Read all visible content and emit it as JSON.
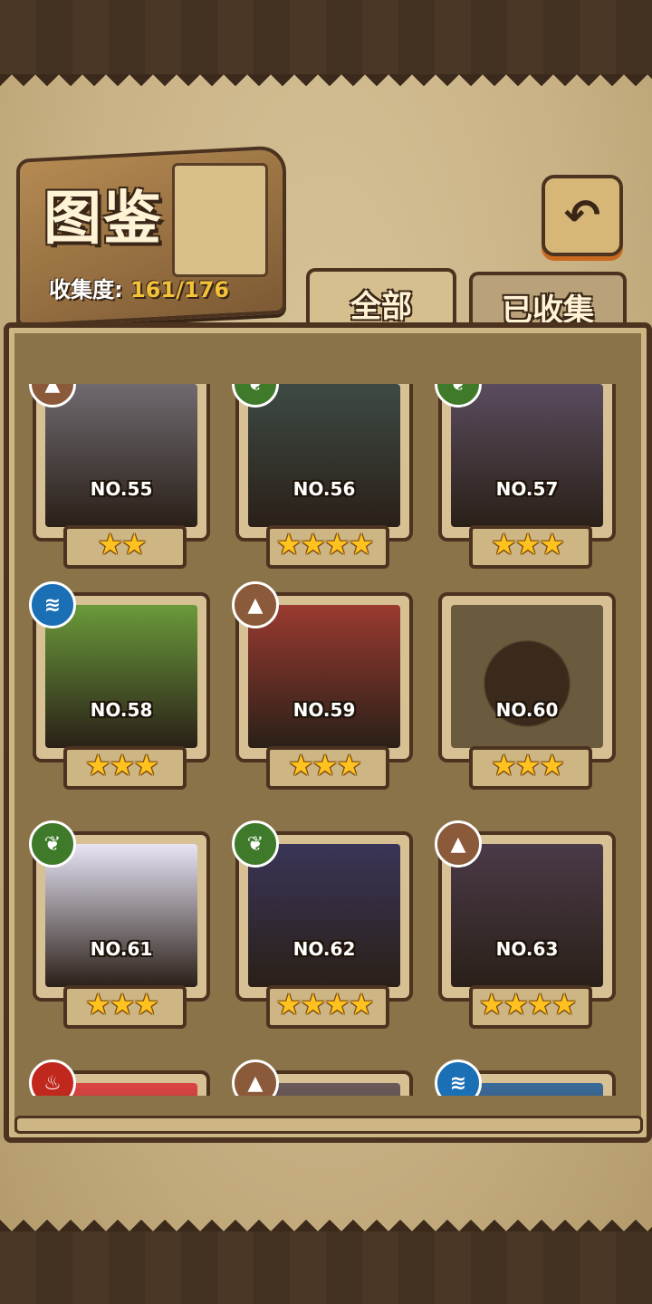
{
  "header": {
    "title": "图鉴",
    "collection_label": "收集度:",
    "collection_value": "161/176",
    "back_icon": "back-arrow-icon"
  },
  "tabs": [
    {
      "label": "全部",
      "selected": true
    },
    {
      "label": "已收集",
      "selected": false
    }
  ],
  "cards": [
    {
      "number": "NO.55",
      "stars": 2,
      "stars_text": "★★",
      "element": "earth",
      "silhouette": false
    },
    {
      "number": "NO.56",
      "stars": 4,
      "stars_text": "★★★★",
      "element": "nature",
      "silhouette": false
    },
    {
      "number": "NO.57",
      "stars": 3,
      "stars_text": "★★★",
      "element": "nature",
      "silhouette": false
    },
    {
      "number": "NO.58",
      "stars": 3,
      "stars_text": "★★★",
      "element": "water",
      "silhouette": false
    },
    {
      "number": "NO.59",
      "stars": 3,
      "stars_text": "★★★",
      "element": "earth",
      "silhouette": false
    },
    {
      "number": "NO.60",
      "stars": 3,
      "stars_text": "★★★",
      "element": "",
      "silhouette": true
    },
    {
      "number": "NO.61",
      "stars": 3,
      "stars_text": "★★★",
      "element": "nature",
      "silhouette": false
    },
    {
      "number": "NO.62",
      "stars": 4,
      "stars_text": "★★★★",
      "element": "nature",
      "silhouette": false
    },
    {
      "number": "NO.63",
      "stars": 4,
      "stars_text": "★★★★",
      "element": "earth",
      "silhouette": false
    },
    {
      "number": "",
      "stars": 0,
      "stars_text": "",
      "element": "fire",
      "silhouette": false
    },
    {
      "number": "",
      "stars": 0,
      "stars_text": "",
      "element": "earth",
      "silhouette": false
    },
    {
      "number": "",
      "stars": 0,
      "stars_text": "",
      "element": "water",
      "silhouette": false
    }
  ],
  "colors": {
    "earth": "#8a5a3a",
    "nature": "#3f7a2a",
    "water": "#1a6fb5",
    "fire": "#c0281e",
    "star": "#ffc21f"
  }
}
